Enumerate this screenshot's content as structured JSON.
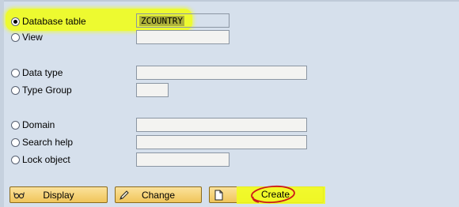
{
  "options": [
    {
      "label": "Database table",
      "selected": true,
      "value": "ZCOUNTRY"
    },
    {
      "label": "View",
      "selected": false,
      "value": ""
    },
    {
      "label": "Data type",
      "selected": false,
      "value": ""
    },
    {
      "label": "Type Group",
      "selected": false,
      "value": ""
    },
    {
      "label": "Domain",
      "selected": false,
      "value": ""
    },
    {
      "label": "Search help",
      "selected": false,
      "value": ""
    },
    {
      "label": "Lock object",
      "selected": false,
      "value": ""
    }
  ],
  "buttons": {
    "display_label": "Display",
    "change_label": "Change",
    "create_label": "Create"
  },
  "colors": {
    "background": "#d6e0ec",
    "highlight": "#effc20",
    "button": "#f4d47a",
    "annotation": "#cc1a1a"
  },
  "icons": {
    "display": "glasses-icon",
    "change": "pencil-icon",
    "create": "new-document-icon"
  }
}
